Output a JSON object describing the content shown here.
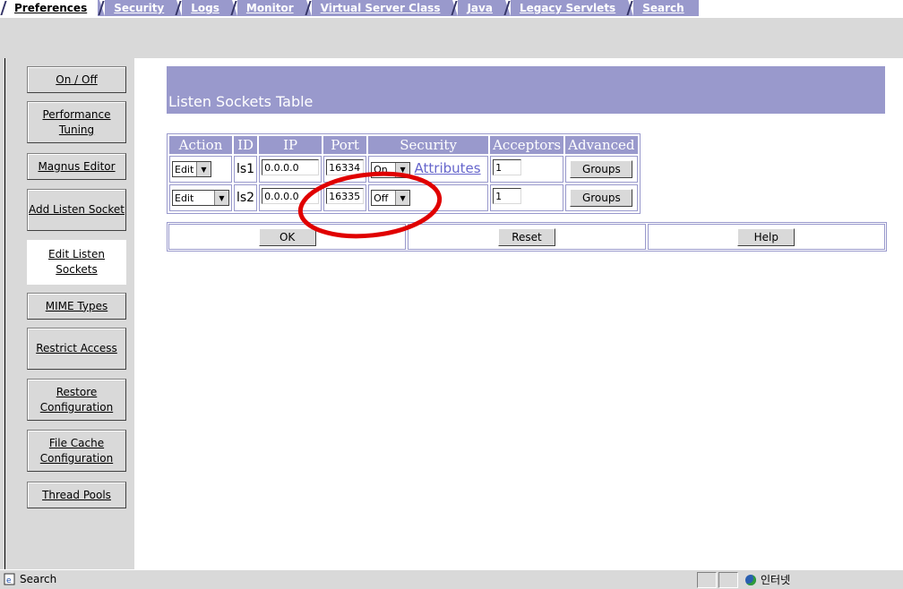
{
  "tabs": [
    "Preferences",
    "Security",
    "Logs",
    "Monitor",
    "Virtual Server Class",
    "Java",
    "Legacy Servlets",
    "Search"
  ],
  "sidebar": {
    "items": [
      "On / Off",
      "Performance Tuning",
      "Magnus Editor",
      "Add Listen Socket",
      "Edit Listen Sockets",
      "MIME Types",
      "Restrict Access",
      "Restore Configuration",
      "File Cache Configuration",
      "Thread Pools"
    ],
    "active_index": 4
  },
  "page": {
    "title": "Listen Sockets Table"
  },
  "table": {
    "headers": [
      "Action",
      "ID",
      "IP",
      "Port",
      "Security",
      "Acceptors",
      "Advanced"
    ],
    "rows": [
      {
        "action": "Edit",
        "id": "ls1",
        "ip": "0.0.0.0",
        "port": "16334",
        "security": "On",
        "attributes_link": "Attributes",
        "acceptors": "1",
        "advanced_btn": "Groups"
      },
      {
        "action": "Edit",
        "id": "ls2",
        "ip": "0.0.0.0",
        "port": "16335",
        "security": "Off",
        "attributes_link": "",
        "acceptors": "1",
        "advanced_btn": "Groups"
      }
    ]
  },
  "actions": {
    "ok": "OK",
    "reset": "Reset",
    "help": "Help"
  },
  "statusbar": {
    "left_text": "Search",
    "zone_text": "인터넷"
  },
  "colors": {
    "accent": "#9999cc",
    "panel_gray": "#d9d9d9",
    "link": "#6666cc",
    "annotation": "#e00000"
  }
}
